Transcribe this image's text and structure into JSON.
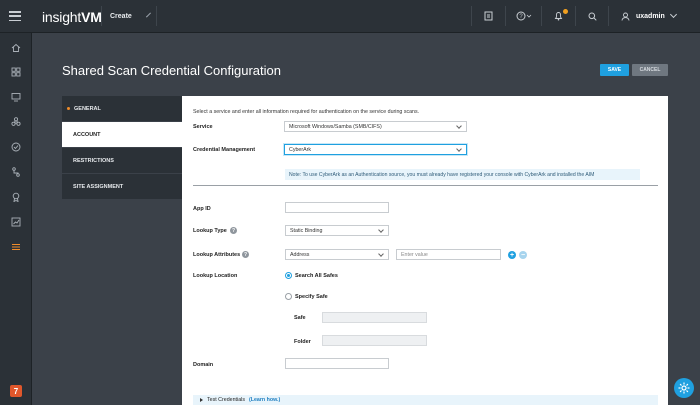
{
  "topbar": {
    "logo_light": "insight",
    "logo_bold": "VM",
    "create_label": "Create",
    "notification_count": "1",
    "username": "uxadmin"
  },
  "page": {
    "title": "Shared Scan Credential Configuration",
    "save_label": "SAVE",
    "cancel_label": "CANCEL"
  },
  "tabs": [
    {
      "label": "GENERAL"
    },
    {
      "label": "ACCOUNT"
    },
    {
      "label": "RESTRICTIONS"
    },
    {
      "label": "SITE ASSIGNMENT"
    }
  ],
  "form": {
    "intro": "Select a service and enter all information required for authentication on the service during scans.",
    "service_label": "Service",
    "service_value": "Microsoft Windows/Samba (SMB/CIFS)",
    "cred_mgmt_label": "Credential Management",
    "cred_mgmt_value": "CyberArk",
    "note": "Note: To use CyberArk as an Authentication source, you must already have registered your console with CyberArk and installed the AIM",
    "app_id_label": "App ID",
    "app_id_value": "",
    "lookup_type_label": "Lookup Type",
    "lookup_type_value": "Static Binding",
    "lookup_attr_label": "Lookup Attributes",
    "lookup_attr_value": "Address",
    "lookup_attr_placeholder": "Enter value",
    "lookup_location_label": "Lookup Location",
    "search_all_label": "Search All Safes",
    "specify_safe_label": "Specify Safe",
    "safe_label": "Safe",
    "folder_label": "Folder",
    "domain_label": "Domain",
    "domain_value": "",
    "test_label": "Test Credentials",
    "learn_how": "(Learn how.)"
  },
  "colors": {
    "accent": "#1fa0e0",
    "topbar": "#2b3137",
    "background": "#3b4149"
  }
}
